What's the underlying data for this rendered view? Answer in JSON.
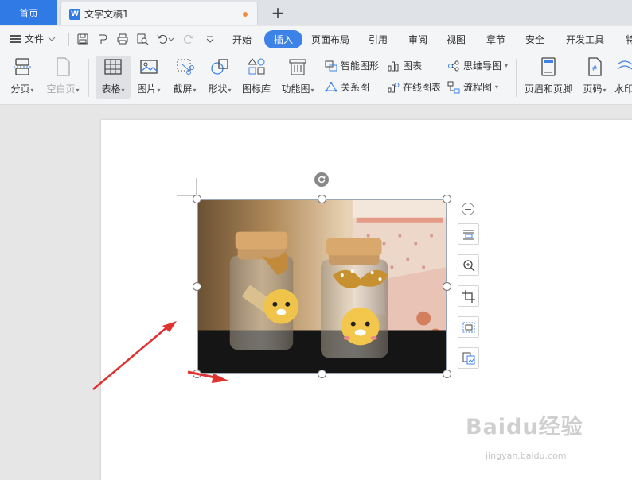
{
  "tabs": {
    "home": "首页",
    "document": {
      "icon_letter": "W",
      "title": "文字文稿1"
    },
    "new_tab": "+"
  },
  "menu": {
    "file": "文件",
    "tabs": [
      "开始",
      "插入",
      "页面布局",
      "引用",
      "审阅",
      "视图",
      "章节",
      "安全",
      "开发工具",
      "特"
    ],
    "active_tab": "插入"
  },
  "ribbon": {
    "buttons": [
      {
        "label": "分页",
        "icon": "page-break-icon",
        "dropdown": true
      },
      {
        "label": "空白页",
        "icon": "blank-page-icon",
        "dropdown": true,
        "disabled": true
      },
      {
        "label": "表格",
        "icon": "table-icon",
        "dropdown": true,
        "selected": true
      },
      {
        "label": "图片",
        "icon": "picture-icon",
        "dropdown": true
      },
      {
        "label": "截屏",
        "icon": "screenshot-icon",
        "dropdown": true
      },
      {
        "label": "形状",
        "icon": "shape-icon",
        "dropdown": true
      },
      {
        "label": "图标库",
        "icon": "icon-library-icon",
        "dropdown": false
      },
      {
        "label": "功能图",
        "icon": "function-chart-icon",
        "dropdown": true
      },
      {
        "label": "页眉和页脚",
        "icon": "header-footer-icon",
        "dropdown": false
      },
      {
        "label": "页码",
        "icon": "page-number-icon",
        "dropdown": true
      },
      {
        "label": "水印",
        "icon": "watermark-icon",
        "dropdown": false
      }
    ],
    "small": {
      "smart_graphic": "智能图形",
      "chart": "图表",
      "mind_map": "思维导图",
      "relation_chart": "关系图",
      "online_chart": "在线图表",
      "flowchart": "流程图"
    }
  },
  "watermark": {
    "brand": "Baidu经验",
    "url": "jingyan.baidu.com"
  },
  "colors": {
    "accent": "#3d82e6",
    "home_tab": "#2f7ae5",
    "annotation_arrow": "#e0312f"
  }
}
